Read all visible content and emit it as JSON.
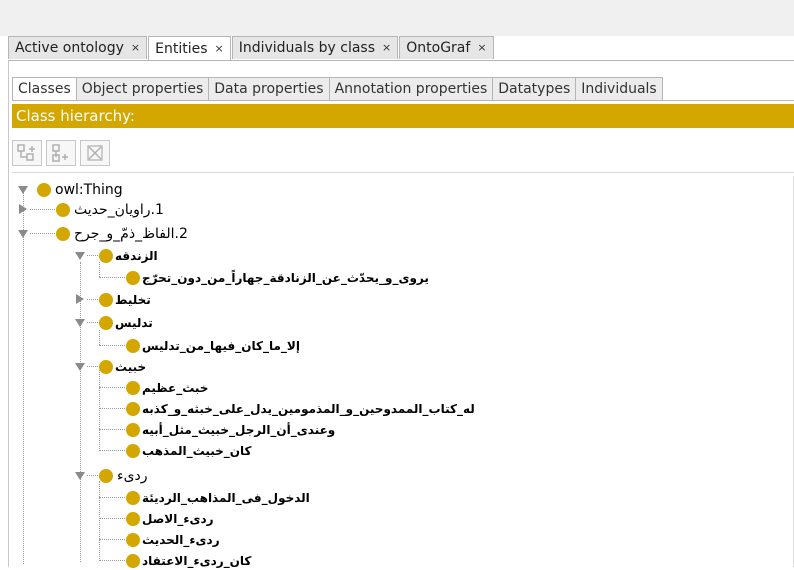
{
  "main_tabs": [
    {
      "label": "Active ontology",
      "close": "×",
      "active": false
    },
    {
      "label": "Entities",
      "close": "×",
      "active": true
    },
    {
      "label": "Individuals by class",
      "close": "×",
      "active": false
    },
    {
      "label": "OntoGraf",
      "close": "×",
      "active": false
    }
  ],
  "entity_tabs": [
    {
      "label": "Classes",
      "active": true
    },
    {
      "label": "Object properties",
      "active": false
    },
    {
      "label": "Data properties",
      "active": false
    },
    {
      "label": "Annotation properties",
      "active": false
    },
    {
      "label": "Datatypes",
      "active": false
    },
    {
      "label": "Individuals",
      "active": false
    }
  ],
  "panel": {
    "title": "Class hierarchy:"
  },
  "toolbar": {
    "add_subclass_icon": "add-subclass-icon",
    "add_sibling_icon": "add-sibling-icon",
    "delete_icon": "delete-class-icon"
  },
  "colors": {
    "accent": "#d4a600",
    "tab_border": "#b5b5b5"
  },
  "tree": {
    "root": "owl:Thing",
    "n1": "1.راويان_حديث",
    "n2": "2.الفاظ_ذمّ_و_جرح",
    "n2_1": "الزندقه",
    "n2_1_1": "يروى_و_يحدّث_عن_الزنادقة_جهاراً_من_دون_تحرّج",
    "n2_2": "تخليط",
    "n2_3": "تدليس",
    "n2_3_1": "إلا_ما_كان_فيها_من_تدليس",
    "n2_4": "خبيث",
    "n2_4_1": "خبث_عظيم",
    "n2_4_2": "له_كتاب_الممدوحين_و_المذمومين_يدل_على_خبثه_و_كذبه",
    "n2_4_3": "وعندى_أن_الرجل_خبيث_مثل_أبيه",
    "n2_4_4": "كان_خبيث_المذهب",
    "n2_5": "ردىء",
    "n2_5_1": "الدخول_فى_المذاهب_الرديئة",
    "n2_5_2": "ردىء_الاصل",
    "n2_5_3": "ردىء_الحديث",
    "n2_5_4": "كان_ردىء_الاعتقاد"
  }
}
